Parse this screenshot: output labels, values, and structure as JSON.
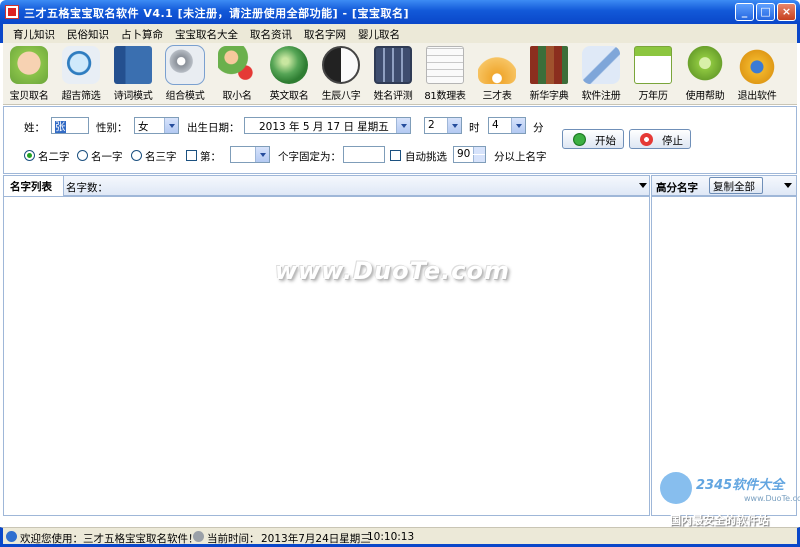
{
  "window": {
    "title": "三才五格宝宝取名软件 V4.1 [未注册，请注册使用全部功能] - [宝宝取名]",
    "min_glyph": "_",
    "max_glyph": "□",
    "close_glyph": "×"
  },
  "menu": [
    "育儿知识",
    "民俗知识",
    "占卜算命",
    "宝宝取名大全",
    "取名资讯",
    "取名字网",
    "婴儿取名"
  ],
  "toolbar": [
    {
      "label": "宝贝取名",
      "icon": "baby-icon",
      "color": "#e9b48a"
    },
    {
      "label": "超吉筛选",
      "icon": "magnifier-icon",
      "color": "#4aa3e0"
    },
    {
      "label": "诗词模式",
      "icon": "book-icon",
      "color": "#3a6fb0"
    },
    {
      "label": "组合模式",
      "icon": "gears-icon",
      "color": "#9aa0a8"
    },
    {
      "label": "取小名",
      "icon": "person-heart-icon",
      "color": "#6ab04c"
    },
    {
      "label": "英文取名",
      "icon": "globe-icon",
      "color": "#56a556"
    },
    {
      "label": "生辰八字",
      "icon": "yinyang-icon",
      "color": "#444444"
    },
    {
      "label": "姓名评测",
      "icon": "calculator-icon",
      "color": "#5a6b8c"
    },
    {
      "label": "81数理表",
      "icon": "number-table-icon",
      "color": "#dcdcdc"
    },
    {
      "label": "三才表",
      "icon": "shell-icon",
      "color": "#f0a830"
    },
    {
      "label": "新华字典",
      "icon": "books-icon",
      "color": "#a0522d"
    },
    {
      "label": "软件注册",
      "icon": "register-icon",
      "color": "#7fa6d9"
    },
    {
      "label": "万年历",
      "icon": "calendar-icon",
      "color": "#8cc63f"
    },
    {
      "label": "使用帮助",
      "icon": "help-icon",
      "color": "#8dc63f"
    },
    {
      "label": "退出软件",
      "icon": "exit-icon",
      "color": "#f0b429"
    }
  ],
  "form": {
    "surname_label": "姓：",
    "surname_value": "张",
    "gender_label": "性别：",
    "gender_value": "女",
    "birth_label": "出生日期：",
    "birth_value": "2013 年 5 月 17 日 星期五",
    "hour_value": "2",
    "hour_label": "时",
    "minute_value": "4",
    "minute_label": "分",
    "start_button": "开始",
    "stop_button": "停止",
    "radio_two": "名二字",
    "radio_one": "名一字",
    "radio_three": "名三字",
    "fix_label": "第：",
    "fix_suffix": "个字固定为：",
    "auto_label": "自动挑选",
    "score_value": "90",
    "score_suffix": "分以上名字"
  },
  "list_panel": {
    "tab": "名字列表",
    "count_label": "名字数："
  },
  "high_panel": {
    "title": "高分名字",
    "copy_button": "复制全部"
  },
  "watermark": {
    "text": "www.DuoTe.com",
    "brand": "2345软件大全",
    "url": "www.DuoTe.com",
    "slogan": "国内最安全的软件站"
  },
  "status": {
    "welcome": "欢迎您使用：三才五格宝宝取名软件！",
    "time_label": "当前时间：",
    "date": "2013年7月24日星期三",
    "clock": "10:10:13"
  }
}
